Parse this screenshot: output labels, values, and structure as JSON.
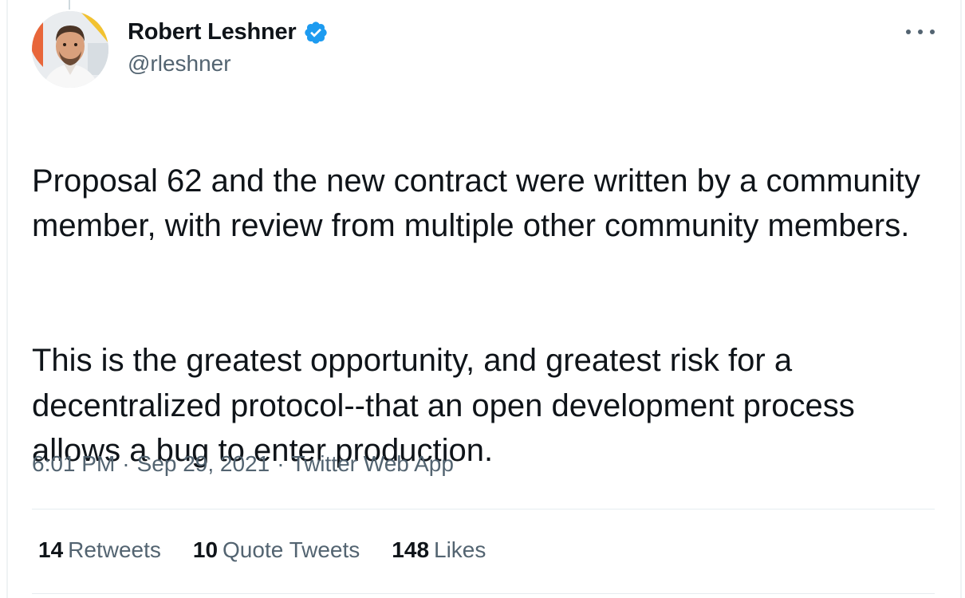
{
  "author": {
    "display_name": "Robert Leshner",
    "handle": "@rleshner",
    "verified": true,
    "verified_color": "#1d9bf0"
  },
  "tweet": {
    "paragraphs": [
      "Proposal 62 and the new contract were written by a community member, with review from multiple other community members.",
      "This is the greatest opportunity, and greatest risk for a decentralized protocol--that an open development process allows a bug to enter production."
    ],
    "time": "6:01 PM",
    "date": "Sep 29, 2021",
    "separator": "·",
    "source": "Twitter Web App"
  },
  "stats": [
    {
      "count": "14",
      "label": "Retweets"
    },
    {
      "count": "10",
      "label": "Quote Tweets"
    },
    {
      "count": "148",
      "label": "Likes"
    }
  ],
  "icons": {
    "more": "more-horizontal-icon",
    "verified": "verified-badge-icon"
  }
}
